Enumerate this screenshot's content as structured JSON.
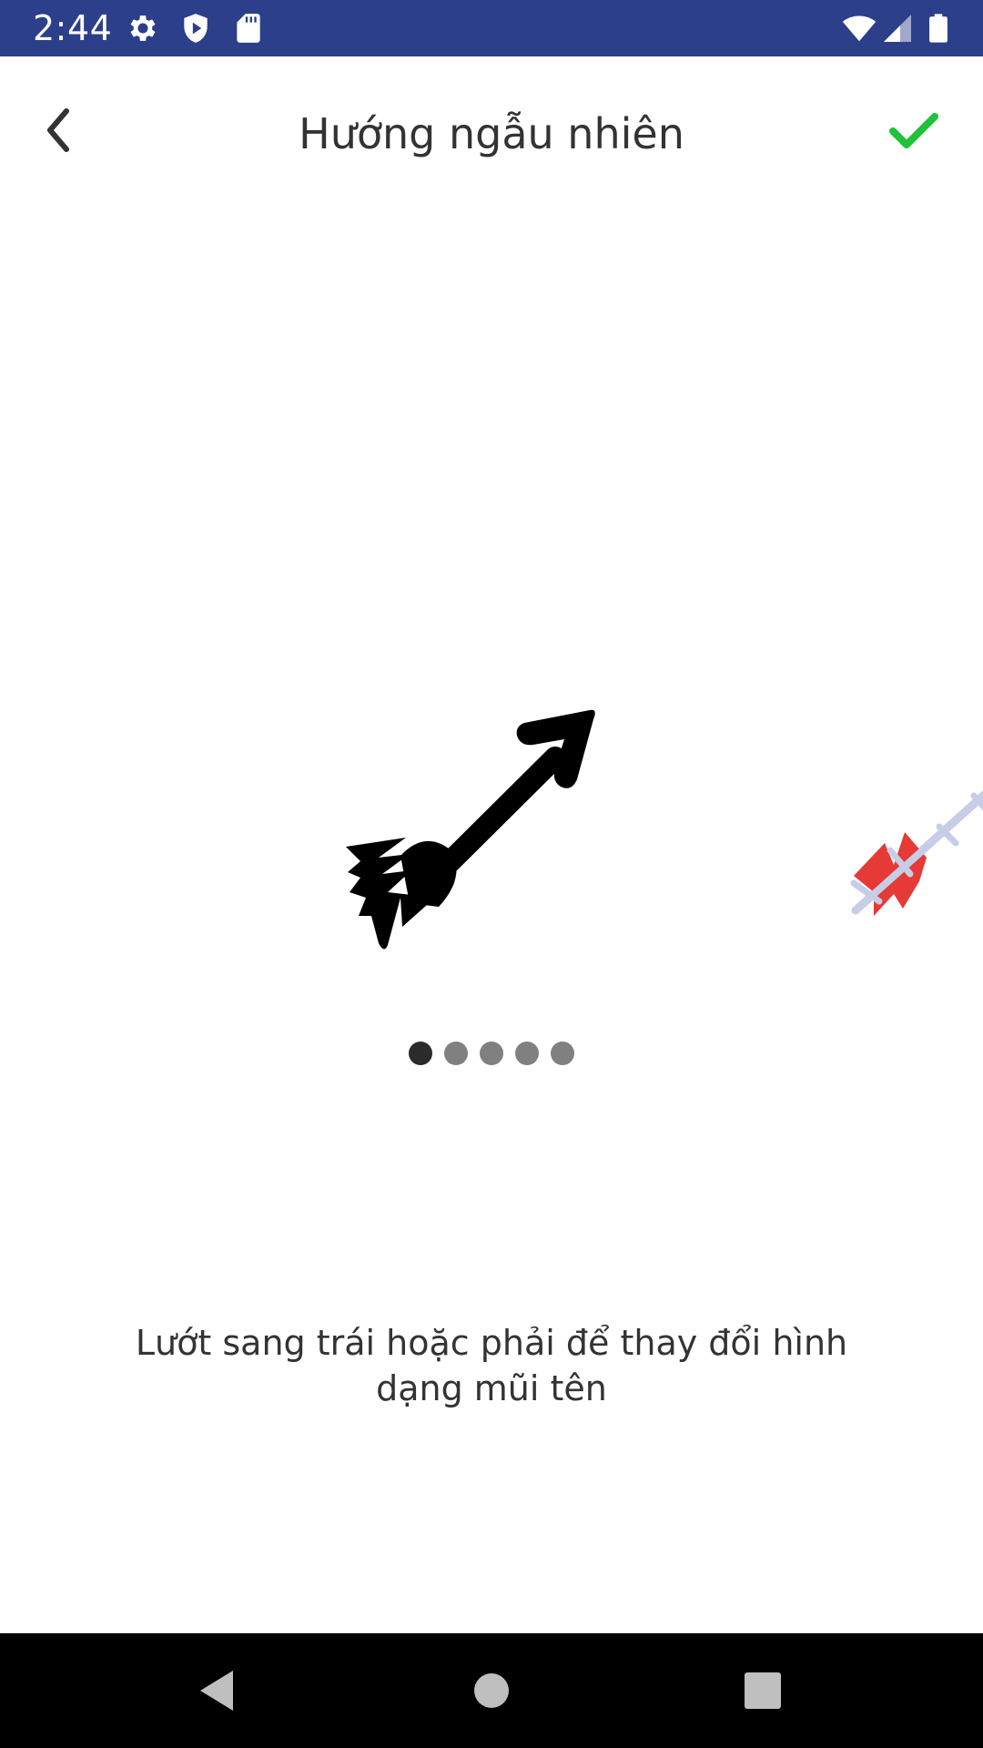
{
  "status_bar": {
    "time": "2:44",
    "background_color": "#2b3f8a",
    "icons": [
      "settings-gear-icon",
      "shield-play-icon",
      "sd-card-icon",
      "wifi-icon",
      "cell-signal-icon",
      "battery-icon"
    ]
  },
  "header": {
    "title": "Hướng ngẫu nhiên",
    "back_icon": "chevron-left-icon",
    "confirm_icon": "checkmark-icon",
    "confirm_color": "#1ec337"
  },
  "carousel": {
    "current_arrow": "black-arrow-icon",
    "next_arrow": "red-fletched-arrow-icon",
    "page_count": 5,
    "active_page": 1
  },
  "instruction": {
    "text": "Lướt sang trái hoặc phải để thay đổi hình dạng mũi tên"
  },
  "nav_bar": {
    "icons": [
      "back-triangle-icon",
      "home-circle-icon",
      "recents-square-icon"
    ]
  }
}
